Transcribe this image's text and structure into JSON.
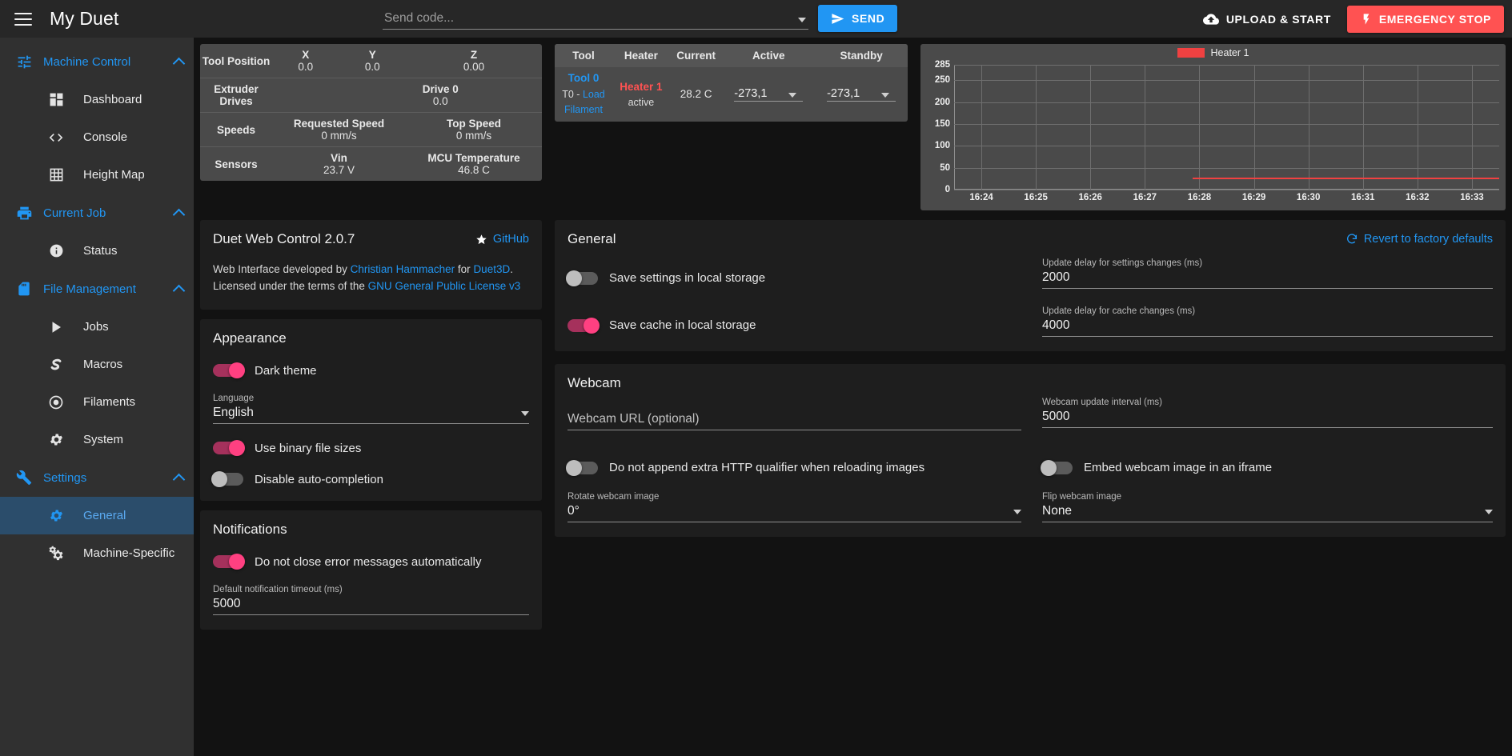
{
  "topbar": {
    "menu_icon": "hamburger-icon",
    "title": "My Duet",
    "code_placeholder": "Send code...",
    "code_value": "",
    "send_label": "SEND",
    "send_icon": "send-icon",
    "upload_label": "UPLOAD & START",
    "upload_icon": "cloud-upload-icon",
    "estop_label": "EMERGENCY STOP",
    "estop_icon": "lightning-bolt-icon",
    "accent_blue": "#2196f3",
    "accent_red": "#ff5252"
  },
  "sidebar": {
    "groups": [
      {
        "label": "Machine Control",
        "icon": "sliders-icon",
        "items": [
          {
            "label": "Dashboard",
            "icon": "dashboard-icon",
            "active": false
          },
          {
            "label": "Console",
            "icon": "code-brackets-icon",
            "active": false
          },
          {
            "label": "Height Map",
            "icon": "grid-icon",
            "active": false
          }
        ]
      },
      {
        "label": "Current Job",
        "icon": "printer-icon",
        "items": [
          {
            "label": "Status",
            "icon": "info-circle-icon",
            "active": false
          }
        ]
      },
      {
        "label": "File Management",
        "icon": "sd-card-icon",
        "items": [
          {
            "label": "Jobs",
            "icon": "play-icon",
            "active": false
          },
          {
            "label": "Macros",
            "icon": "macro-icon",
            "active": false
          },
          {
            "label": "Filaments",
            "icon": "filament-circle-icon",
            "active": false
          },
          {
            "label": "System",
            "icon": "gear-icon",
            "active": false
          }
        ]
      },
      {
        "label": "Settings",
        "icon": "wrench-icon",
        "items": [
          {
            "label": "General",
            "icon": "gear-icon",
            "active": true
          },
          {
            "label": "Machine-Specific",
            "icon": "gears-icon",
            "active": false
          }
        ]
      }
    ]
  },
  "status": {
    "position": {
      "row_label": "Tool Position",
      "columns": [
        "X",
        "Y",
        "Z"
      ],
      "values": [
        "0.0",
        "0.0",
        "0.00"
      ]
    },
    "extruders": {
      "row_label": "Extruder Drives",
      "columns": [
        "Drive 0"
      ],
      "values": [
        "0.0"
      ]
    },
    "speeds": {
      "row_label": "Speeds",
      "columns": [
        "Requested Speed",
        "Top Speed"
      ],
      "values": [
        "0 mm/s",
        "0 mm/s"
      ]
    },
    "sensors": {
      "row_label": "Sensors",
      "columns": [
        "Vin",
        "MCU Temperature"
      ],
      "values": [
        "23.7 V",
        "46.8 C"
      ]
    }
  },
  "tools": {
    "columns": [
      "Tool",
      "Heater",
      "Current",
      "Active",
      "Standby"
    ],
    "rows": [
      {
        "tool_name": "Tool 0",
        "tool_sub_prefix": "T0 - ",
        "tool_sub_link": "Load",
        "tool_sub_link2": "Filament",
        "heater_name": "Heater 1",
        "heater_state": "active",
        "current": "28.2 C",
        "active_temp": "-273,1",
        "standby_temp": "-273,1"
      }
    ]
  },
  "chart_data": {
    "type": "line",
    "title": "",
    "legend": [
      {
        "name": "Heater 1",
        "color": "#f04141"
      }
    ],
    "legend_position": "top-center",
    "xlabel": "",
    "ylabel": "",
    "x_ticks": [
      "16:24",
      "16:25",
      "16:26",
      "16:27",
      "16:28",
      "16:29",
      "16:30",
      "16:31",
      "16:32",
      "16:33"
    ],
    "y_ticks": [
      0,
      50,
      100,
      150,
      200,
      250,
      285
    ],
    "ylim": [
      0,
      285
    ],
    "grid": true,
    "series": [
      {
        "name": "Heater 1",
        "color": "#f04141",
        "x": [
          "16:27.9",
          "16:28",
          "16:29",
          "16:30",
          "16:31",
          "16:32",
          "16:33"
        ],
        "values": [
          28.2,
          28.2,
          28.2,
          28.2,
          28.2,
          28.2,
          28.2
        ]
      }
    ]
  },
  "about": {
    "title": "Duet Web Control 2.0.7",
    "github_label": "GitHub",
    "github_icon": "star-icon",
    "line1_pre": "Web Interface developed by ",
    "line1_author": "Christian Hammacher",
    "line1_mid": " for ",
    "line1_company": "Duet3D",
    "line1_post": ".",
    "line2_pre": "Licensed under the terms of the ",
    "line2_license": "GNU General Public License v3"
  },
  "appearance": {
    "title": "Appearance",
    "dark_theme": {
      "label": "Dark theme",
      "on": true
    },
    "language": {
      "label": "Language",
      "value": "English"
    },
    "binary_sizes": {
      "label": "Use binary file sizes",
      "on": true
    },
    "disable_autocomplete": {
      "label": "Disable auto-completion",
      "on": false
    }
  },
  "notifications": {
    "title": "Notifications",
    "no_autoclose": {
      "label": "Do not close error messages automatically",
      "on": true
    },
    "timeout": {
      "label": "Default notification timeout (ms)",
      "value": "5000"
    }
  },
  "general": {
    "title": "General",
    "revert_label": "Revert to factory defaults",
    "revert_icon": "refresh-icon",
    "save_settings": {
      "label": "Save settings in local storage",
      "on": false
    },
    "save_cache": {
      "label": "Save cache in local storage",
      "on": true
    },
    "settings_delay": {
      "label": "Update delay for settings changes (ms)",
      "value": "2000"
    },
    "cache_delay": {
      "label": "Update delay for cache changes (ms)",
      "value": "4000"
    }
  },
  "webcam": {
    "title": "Webcam",
    "url": {
      "label": "",
      "placeholder": "Webcam URL (optional)",
      "value": ""
    },
    "interval": {
      "label": "Webcam update interval (ms)",
      "value": "5000"
    },
    "no_qualifier": {
      "label": "Do not append extra HTTP qualifier when reloading images",
      "on": false
    },
    "iframe": {
      "label": "Embed webcam image in an iframe",
      "on": false
    },
    "rotate": {
      "label": "Rotate webcam image",
      "value": "0°"
    },
    "flip": {
      "label": "Flip webcam image",
      "value": "None"
    }
  }
}
